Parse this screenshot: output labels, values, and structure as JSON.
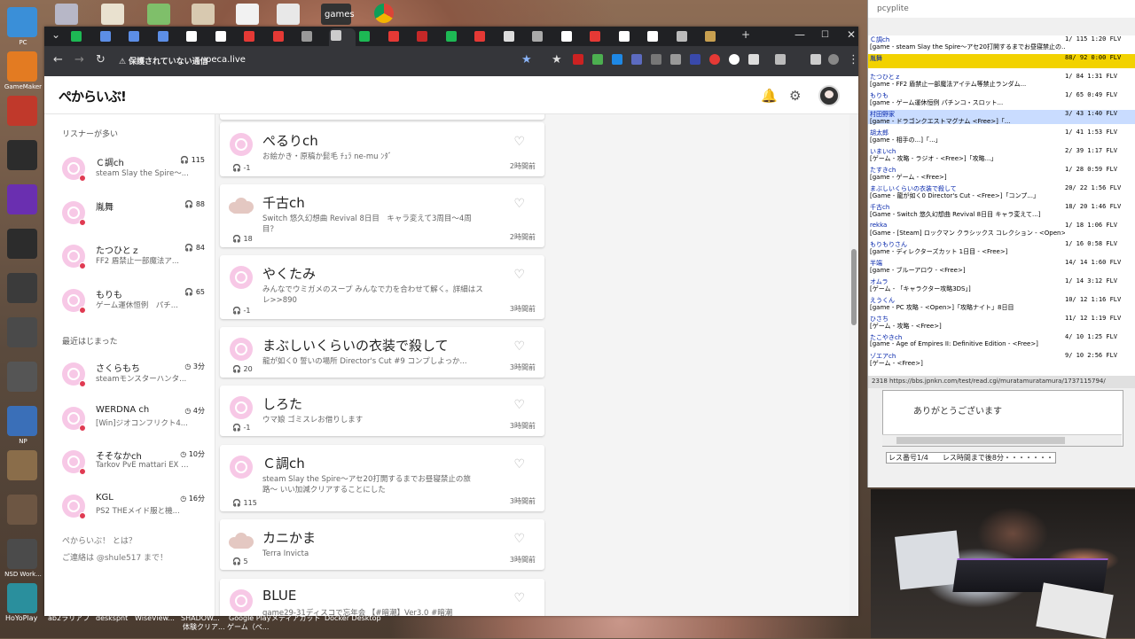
{
  "desktop": {
    "icons": [
      {
        "label": "PC",
        "color": "#3a8fd8"
      },
      {
        "label": "GameMaker",
        "color": "#e37b22"
      },
      {
        "label": "",
        "color": "#c0392b"
      },
      {
        "label": "",
        "color": "#2c2c2c"
      },
      {
        "label": "",
        "color": "#6a2fb0"
      },
      {
        "label": "",
        "color": "#2c2c2c"
      },
      {
        "label": "",
        "color": "#3b3b3b"
      },
      {
        "label": "",
        "color": "#4a4a4a"
      },
      {
        "label": "",
        "color": "#555555"
      },
      {
        "label": "NP",
        "color": "#3a6fb8"
      },
      {
        "label": "",
        "color": "#8a6d4a"
      },
      {
        "label": "",
        "color": "#6d5643"
      },
      {
        "label": "NSD Work...",
        "color": "#4b4b4b"
      },
      {
        "label": "",
        "color": "#2a8f9d"
      }
    ],
    "top_label": "games",
    "bottom_labels": [
      "HoYoPlay",
      "ab2ラリアフ",
      "deskspnt",
      "WiseView...",
      "SHADOW...",
      "Google Play",
      "メディアカット",
      "Docker Desktop",
      "体験クリア...",
      "ゲーム（ベ..."
    ]
  },
  "browser": {
    "tabs_count": 23,
    "security_warning": "保護されていない通信",
    "url": "peca.live",
    "window_controls": {
      "minimize": "—",
      "maximize": "☐",
      "close": "✕"
    }
  },
  "site": {
    "logo": "ぺからいぶ!",
    "header_icons": [
      "notification-bell-icon",
      "settings-gear-icon"
    ],
    "sidebar": {
      "popular_heading": "リスナーが多い",
      "popular": [
        {
          "name": "Ｃ調ch",
          "count": "115",
          "desc": "steam Slay the Spire〜..."
        },
        {
          "name": "胤舞",
          "count": "88",
          "desc": ""
        },
        {
          "name": "たつひとｚ",
          "count": "84",
          "desc": "FF2 盾禁止一部魔法ア..."
        },
        {
          "name": "もりも",
          "count": "65",
          "desc": "ゲーム運休恒例　パチ..."
        }
      ],
      "recent_heading": "最近はじまった",
      "recent": [
        {
          "name": "さくらもち",
          "time": "3分",
          "desc": "steamモンスターハンタ..."
        },
        {
          "name": "WERDNA ch",
          "time": "4分",
          "desc": "[Win]ジオコンフリクト4..."
        },
        {
          "name": "そそなかch",
          "time": "10分",
          "desc": "Tarkov PvE mattari EX L..."
        },
        {
          "name": "KGL",
          "time": "16分",
          "desc": "PS2 THEメイド服と機..."
        }
      ],
      "about_link": "ぺからいぶ！ とは？",
      "contact": "ご連絡は @shule517 まで！"
    },
    "channels": [
      {
        "name": "ぺるりch",
        "desc": "お絵かき・原稿か髭毛 ﾁｭﾗ ne-mu ﾝﾀﾞ",
        "listeners": "-1",
        "time": "2時間前",
        "avatar": "pink"
      },
      {
        "name": "千古ch",
        "desc": "Switch 悠久幻想曲 Revival 8日目　キャラ変えて3周目〜4周目？",
        "listeners": "18",
        "time": "2時間前",
        "avatar": "cloud"
      },
      {
        "name": "やくたみ",
        "desc": "みんなでウミガメのスープ みんなで力を合わせて解く。詳細はスレ>>890",
        "listeners": "-1",
        "time": "3時間前",
        "avatar": "pink"
      },
      {
        "name": "まぶしいくらいの衣装で殺して",
        "desc": "龍が如く0 誓いの場所 Director's Cut #9 コンプしよっか...",
        "listeners": "20",
        "time": "3時間前",
        "avatar": "pink"
      },
      {
        "name": "しろた",
        "desc": "ウマ娘 ゴミスレお借りします",
        "listeners": "-1",
        "time": "3時間前",
        "avatar": "pink"
      },
      {
        "name": "Ｃ調ch",
        "desc": "steam Slay the Spire〜アセ20打開するまでお昼寝禁止の旅路〜 いい加減クリアすることにした",
        "listeners": "115",
        "time": "3時間前",
        "avatar": "pink"
      },
      {
        "name": "カニかま",
        "desc": "Terra Invicta",
        "listeners": "5",
        "time": "3時間前",
        "avatar": "cloud"
      },
      {
        "name": "BLUE",
        "desc": "game29-31ディスコで忘年会 【#暗潮】Ver3.0 #暗潮",
        "listeners": "",
        "time": "",
        "avatar": "pink"
      }
    ]
  },
  "peercast": {
    "title": "pcyplite",
    "rows": [
      {
        "n": "Ｃ調ch",
        "d": "[game - steam Slay the Spire〜アセ20打開するまでお昼寝禁止の...",
        "s": "1/ 115  1:20  FLV"
      },
      {
        "n": "胤舞",
        "d": "",
        "s": "88/ 92  0:00  FLV"
      },
      {
        "n": "たつひとｚ",
        "d": "[game - FF2 盾禁止一部魔法アイテム等禁止ランダム...",
        "s": "1/ 84  1:31  FLV"
      },
      {
        "n": "もりも",
        "d": "[game - ゲーム運休恒例 パチンコ・スロット...",
        "s": "1/ 65  0:49  FLV"
      },
      {
        "n": "村田野家",
        "d": "[game - ドラゴンクエストマグナム <Free>]「...",
        "s": "3/ 43  1:40  FLV"
      },
      {
        "n": "胡太郎",
        "d": "[game - 相手の...]「...」",
        "s": "1/ 41  1:53  FLV"
      },
      {
        "n": "いまいch",
        "d": "[ゲーム - 攻略 - ラジオ - <Free>]「攻略...」",
        "s": "2/ 39  1:17  FLV"
      },
      {
        "n": "たすきch",
        "d": "[game - ゲーム - <Free>]",
        "s": "1/ 28  0:59  FLV"
      },
      {
        "n": "まぶしいくらいの衣装で殺して",
        "d": "[Game - 龍が如く0 Director's Cut - <Free>]「コンプ...」",
        "s": "20/ 22  1:56  FLV"
      },
      {
        "n": "千古ch",
        "d": "[Game - Switch 悠久幻想曲 Revival 8日目 キャラ変えて...]",
        "s": "18/ 20  1:46  FLV"
      },
      {
        "n": "rekka",
        "d": "[Game - [Steam] ロックマン クラシックス コレクション - <Open>]",
        "s": "1/ 18  1:06  FLV"
      },
      {
        "n": "もりもりさん",
        "d": "[game - ディレクターズカット 1日目 - <Free>]",
        "s": "1/ 16  0:58  FLV"
      },
      {
        "n": "半端",
        "d": "[game - ブルーアロウ - <Free>]",
        "s": "14/ 14  1:60  FLV"
      },
      {
        "n": "オムラ",
        "d": "[ゲーム - 「キャラクター攻略3DS」]",
        "s": "1/ 14  3:12  FLV"
      },
      {
        "n": "えうくん",
        "d": "[game - PC 攻略 - <Open>]「攻略ナイト」8日目",
        "s": "10/ 12  1:16  FLV"
      },
      {
        "n": "ひさち",
        "d": "[ゲーム - 攻略 - <Free>]",
        "s": "11/ 12  1:19  FLV"
      },
      {
        "n": "たこやきch",
        "d": "[game - Age of Empires II: Definitive Edition - <Free>]",
        "s": "4/ 10  1:25  FLV"
      },
      {
        "n": "ゾエアch",
        "d": "[ゲーム - <Free>]",
        "s": "9/ 10  2:56  FLV"
      }
    ],
    "url_line": "2318 https://bbs.jpnkn.com/test/read.cgi/muratamuratamura/1737115794/",
    "chat_text": "ありがとうございます",
    "status_text": "レス番号1/4　　レス時間まで後8分・・・・・・・"
  }
}
